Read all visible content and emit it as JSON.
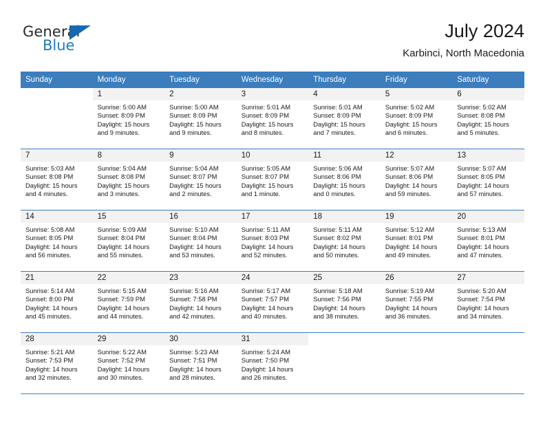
{
  "brand": {
    "name_part1": "General",
    "name_part2": "Blue",
    "logo_icon": "blue-triangle-logo"
  },
  "header": {
    "title": "July 2024",
    "subtitle": "Karbinci, North Macedonia"
  },
  "colors": {
    "header_blue": "#3b7dbd",
    "brand_blue": "#1f7ac0",
    "day_band_gray": "#f2f2f2",
    "text": "#1a1a1a"
  },
  "labels": {
    "sunrise_prefix": "Sunrise:",
    "sunset_prefix": "Sunset:",
    "daylight_prefix": "Daylight:"
  },
  "weekday_headers": [
    "Sunday",
    "Monday",
    "Tuesday",
    "Wednesday",
    "Thursday",
    "Friday",
    "Saturday"
  ],
  "weeks": [
    [
      {
        "day": "",
        "sunrise": "",
        "sunset": "",
        "daylight_line1": "",
        "daylight_line2": "",
        "empty": true
      },
      {
        "day": "1",
        "sunrise": "Sunrise: 5:00 AM",
        "sunset": "Sunset: 8:09 PM",
        "daylight_line1": "Daylight: 15 hours",
        "daylight_line2": "and 9 minutes."
      },
      {
        "day": "2",
        "sunrise": "Sunrise: 5:00 AM",
        "sunset": "Sunset: 8:09 PM",
        "daylight_line1": "Daylight: 15 hours",
        "daylight_line2": "and 9 minutes."
      },
      {
        "day": "3",
        "sunrise": "Sunrise: 5:01 AM",
        "sunset": "Sunset: 8:09 PM",
        "daylight_line1": "Daylight: 15 hours",
        "daylight_line2": "and 8 minutes."
      },
      {
        "day": "4",
        "sunrise": "Sunrise: 5:01 AM",
        "sunset": "Sunset: 8:09 PM",
        "daylight_line1": "Daylight: 15 hours",
        "daylight_line2": "and 7 minutes."
      },
      {
        "day": "5",
        "sunrise": "Sunrise: 5:02 AM",
        "sunset": "Sunset: 8:09 PM",
        "daylight_line1": "Daylight: 15 hours",
        "daylight_line2": "and 6 minutes."
      },
      {
        "day": "6",
        "sunrise": "Sunrise: 5:02 AM",
        "sunset": "Sunset: 8:08 PM",
        "daylight_line1": "Daylight: 15 hours",
        "daylight_line2": "and 5 minutes."
      }
    ],
    [
      {
        "day": "7",
        "sunrise": "Sunrise: 5:03 AM",
        "sunset": "Sunset: 8:08 PM",
        "daylight_line1": "Daylight: 15 hours",
        "daylight_line2": "and 4 minutes."
      },
      {
        "day": "8",
        "sunrise": "Sunrise: 5:04 AM",
        "sunset": "Sunset: 8:08 PM",
        "daylight_line1": "Daylight: 15 hours",
        "daylight_line2": "and 3 minutes."
      },
      {
        "day": "9",
        "sunrise": "Sunrise: 5:04 AM",
        "sunset": "Sunset: 8:07 PM",
        "daylight_line1": "Daylight: 15 hours",
        "daylight_line2": "and 2 minutes."
      },
      {
        "day": "10",
        "sunrise": "Sunrise: 5:05 AM",
        "sunset": "Sunset: 8:07 PM",
        "daylight_line1": "Daylight: 15 hours",
        "daylight_line2": "and 1 minute."
      },
      {
        "day": "11",
        "sunrise": "Sunrise: 5:06 AM",
        "sunset": "Sunset: 8:06 PM",
        "daylight_line1": "Daylight: 15 hours",
        "daylight_line2": "and 0 minutes."
      },
      {
        "day": "12",
        "sunrise": "Sunrise: 5:07 AM",
        "sunset": "Sunset: 8:06 PM",
        "daylight_line1": "Daylight: 14 hours",
        "daylight_line2": "and 59 minutes."
      },
      {
        "day": "13",
        "sunrise": "Sunrise: 5:07 AM",
        "sunset": "Sunset: 8:05 PM",
        "daylight_line1": "Daylight: 14 hours",
        "daylight_line2": "and 57 minutes."
      }
    ],
    [
      {
        "day": "14",
        "sunrise": "Sunrise: 5:08 AM",
        "sunset": "Sunset: 8:05 PM",
        "daylight_line1": "Daylight: 14 hours",
        "daylight_line2": "and 56 minutes."
      },
      {
        "day": "15",
        "sunrise": "Sunrise: 5:09 AM",
        "sunset": "Sunset: 8:04 PM",
        "daylight_line1": "Daylight: 14 hours",
        "daylight_line2": "and 55 minutes."
      },
      {
        "day": "16",
        "sunrise": "Sunrise: 5:10 AM",
        "sunset": "Sunset: 8:04 PM",
        "daylight_line1": "Daylight: 14 hours",
        "daylight_line2": "and 53 minutes."
      },
      {
        "day": "17",
        "sunrise": "Sunrise: 5:11 AM",
        "sunset": "Sunset: 8:03 PM",
        "daylight_line1": "Daylight: 14 hours",
        "daylight_line2": "and 52 minutes."
      },
      {
        "day": "18",
        "sunrise": "Sunrise: 5:11 AM",
        "sunset": "Sunset: 8:02 PM",
        "daylight_line1": "Daylight: 14 hours",
        "daylight_line2": "and 50 minutes."
      },
      {
        "day": "19",
        "sunrise": "Sunrise: 5:12 AM",
        "sunset": "Sunset: 8:01 PM",
        "daylight_line1": "Daylight: 14 hours",
        "daylight_line2": "and 49 minutes."
      },
      {
        "day": "20",
        "sunrise": "Sunrise: 5:13 AM",
        "sunset": "Sunset: 8:01 PM",
        "daylight_line1": "Daylight: 14 hours",
        "daylight_line2": "and 47 minutes."
      }
    ],
    [
      {
        "day": "21",
        "sunrise": "Sunrise: 5:14 AM",
        "sunset": "Sunset: 8:00 PM",
        "daylight_line1": "Daylight: 14 hours",
        "daylight_line2": "and 45 minutes."
      },
      {
        "day": "22",
        "sunrise": "Sunrise: 5:15 AM",
        "sunset": "Sunset: 7:59 PM",
        "daylight_line1": "Daylight: 14 hours",
        "daylight_line2": "and 44 minutes."
      },
      {
        "day": "23",
        "sunrise": "Sunrise: 5:16 AM",
        "sunset": "Sunset: 7:58 PM",
        "daylight_line1": "Daylight: 14 hours",
        "daylight_line2": "and 42 minutes."
      },
      {
        "day": "24",
        "sunrise": "Sunrise: 5:17 AM",
        "sunset": "Sunset: 7:57 PM",
        "daylight_line1": "Daylight: 14 hours",
        "daylight_line2": "and 40 minutes."
      },
      {
        "day": "25",
        "sunrise": "Sunrise: 5:18 AM",
        "sunset": "Sunset: 7:56 PM",
        "daylight_line1": "Daylight: 14 hours",
        "daylight_line2": "and 38 minutes."
      },
      {
        "day": "26",
        "sunrise": "Sunrise: 5:19 AM",
        "sunset": "Sunset: 7:55 PM",
        "daylight_line1": "Daylight: 14 hours",
        "daylight_line2": "and 36 minutes."
      },
      {
        "day": "27",
        "sunrise": "Sunrise: 5:20 AM",
        "sunset": "Sunset: 7:54 PM",
        "daylight_line1": "Daylight: 14 hours",
        "daylight_line2": "and 34 minutes."
      }
    ],
    [
      {
        "day": "28",
        "sunrise": "Sunrise: 5:21 AM",
        "sunset": "Sunset: 7:53 PM",
        "daylight_line1": "Daylight: 14 hours",
        "daylight_line2": "and 32 minutes."
      },
      {
        "day": "29",
        "sunrise": "Sunrise: 5:22 AM",
        "sunset": "Sunset: 7:52 PM",
        "daylight_line1": "Daylight: 14 hours",
        "daylight_line2": "and 30 minutes."
      },
      {
        "day": "30",
        "sunrise": "Sunrise: 5:23 AM",
        "sunset": "Sunset: 7:51 PM",
        "daylight_line1": "Daylight: 14 hours",
        "daylight_line2": "and 28 minutes."
      },
      {
        "day": "31",
        "sunrise": "Sunrise: 5:24 AM",
        "sunset": "Sunset: 7:50 PM",
        "daylight_line1": "Daylight: 14 hours",
        "daylight_line2": "and 26 minutes."
      },
      {
        "day": "",
        "sunrise": "",
        "sunset": "",
        "daylight_line1": "",
        "daylight_line2": "",
        "empty": true
      },
      {
        "day": "",
        "sunrise": "",
        "sunset": "",
        "daylight_line1": "",
        "daylight_line2": "",
        "empty": true
      },
      {
        "day": "",
        "sunrise": "",
        "sunset": "",
        "daylight_line1": "",
        "daylight_line2": "",
        "empty": true
      }
    ]
  ]
}
